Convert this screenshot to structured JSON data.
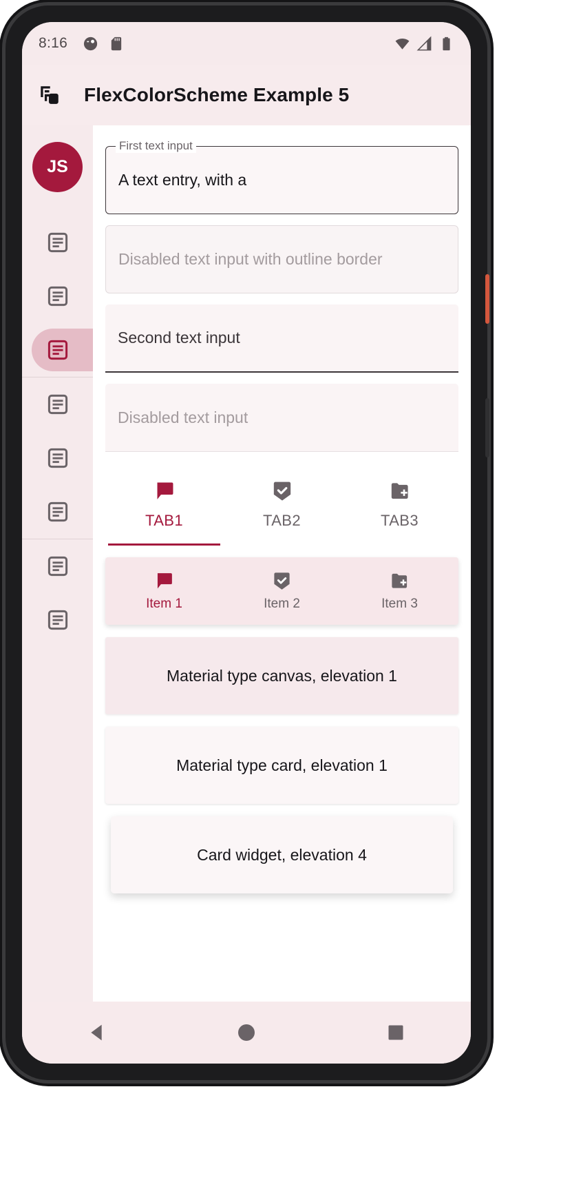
{
  "theme": {
    "primary": "#a4193d",
    "app_bar_bg": "#f7ebed",
    "rail_bg": "#f6eaec",
    "rail_selected_pill": "#e5bcc6",
    "nav_bar_bg": "#f7e7ea",
    "canvas_surface": "#f6e9ec",
    "card_surface": "#fbf6f7",
    "on_surface": "#17161a",
    "muted": "#6a6367",
    "disabled": "#a39b9e"
  },
  "status_bar": {
    "time": "8:16",
    "left_icons": [
      "data-saver-icon",
      "sd-card-icon"
    ],
    "right_icons": [
      "wifi-icon",
      "cellular-signal-icon",
      "battery-icon"
    ]
  },
  "app_bar": {
    "leading_icon": "layers-copy-icon",
    "title": "FlexColorScheme Example 5"
  },
  "nav_rail": {
    "avatar_initials": "JS",
    "items": [
      {
        "icon": "article-icon",
        "selected": false
      },
      {
        "icon": "article-icon",
        "selected": false
      },
      {
        "icon": "article-icon",
        "selected": true
      },
      {
        "icon": "article-icon",
        "selected": false
      },
      {
        "icon": "article-icon",
        "selected": false
      },
      {
        "icon": "article-icon",
        "selected": false
      },
      {
        "icon": "article-icon",
        "selected": false
      },
      {
        "icon": "article-icon",
        "selected": false
      }
    ]
  },
  "form": {
    "first_field": {
      "label": "First text input",
      "value": "A text entry, with a",
      "style": "outline",
      "enabled": true
    },
    "disabled_outline_field": {
      "placeholder": "Disabled text input with outline border",
      "style": "outline",
      "enabled": false
    },
    "second_field": {
      "placeholder": "Second text input",
      "style": "filled",
      "enabled": true
    },
    "disabled_filled_field": {
      "placeholder": "Disabled text input",
      "style": "filled",
      "enabled": false
    }
  },
  "tab_bar": {
    "tabs": [
      {
        "label": "TAB1",
        "icon": "chat-bubble-icon",
        "selected": true
      },
      {
        "label": "TAB2",
        "icon": "beenhere-check-icon",
        "selected": false
      },
      {
        "label": "TAB3",
        "icon": "create-new-folder-icon",
        "selected": false
      }
    ]
  },
  "nav_bar": {
    "items": [
      {
        "label": "Item 1",
        "icon": "chat-bubble-icon",
        "selected": true
      },
      {
        "label": "Item 2",
        "icon": "beenhere-check-icon",
        "selected": false
      },
      {
        "label": "Item 3",
        "icon": "create-new-folder-icon",
        "selected": false
      }
    ]
  },
  "surfaces": [
    {
      "label": "Material type canvas, elevation 1"
    },
    {
      "label": "Material type card, elevation 1"
    },
    {
      "label": "Card widget, elevation 4"
    }
  ],
  "system_nav": {
    "buttons": [
      "back-triangle-icon",
      "home-circle-icon",
      "recents-square-icon"
    ]
  }
}
